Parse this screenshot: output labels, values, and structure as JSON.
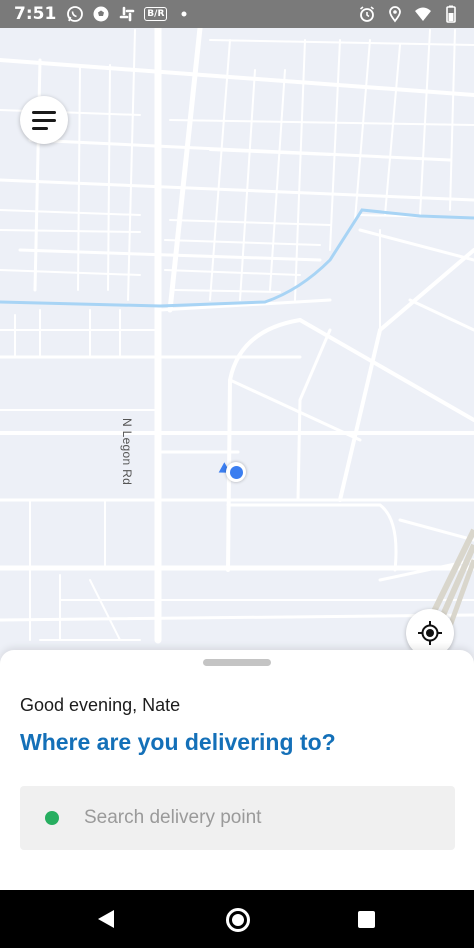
{
  "status_bar": {
    "time": "7:51",
    "left_icons": [
      "whatsapp-icon",
      "soccer-ball-icon",
      "slack-icon",
      "br-badge-icon",
      "dot-icon"
    ],
    "br_badge_text": "B/R",
    "right_icons": [
      "alarm-icon",
      "location-pin-icon",
      "wifi-icon",
      "battery-icon"
    ]
  },
  "map": {
    "road_label": "N Legon Rd",
    "menu_icon": "hamburger-menu-icon",
    "locate_icon": "my-location-icon"
  },
  "sheet": {
    "greeting": "Good evening, Nate",
    "headline": "Where are you delivering to?",
    "search_placeholder": "Search delivery point",
    "accent_color": "#1470b8",
    "dot_color": "#27ae60"
  },
  "nav_bar": {
    "icons": [
      "back-icon",
      "home-icon",
      "recents-icon"
    ]
  }
}
